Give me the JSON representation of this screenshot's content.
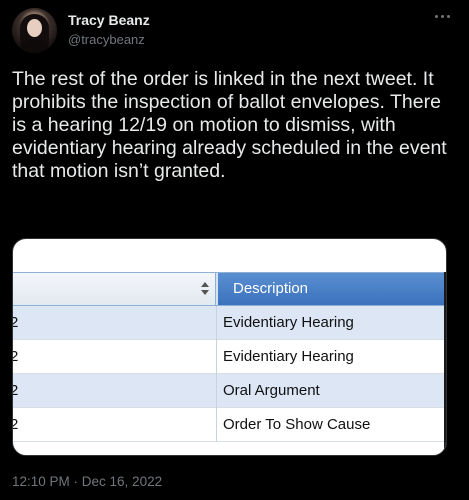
{
  "author": {
    "display_name": "Tracy Beanz",
    "handle": "@tracybeanz"
  },
  "tweet": {
    "text": "The rest of the order is linked in the next tweet. It prohibits the inspection of ballot envelopes. There is a hearing 12/19 on motion to dismiss, with evidentiary hearing already scheduled in the event that motion isn’t granted.",
    "timestamp": "12:10 PM · Dec 16, 2022"
  },
  "media": {
    "table": {
      "header": {
        "description": "Description"
      },
      "rows": [
        {
          "num": "2",
          "description": "Evidentiary Hearing"
        },
        {
          "num": "2",
          "description": "Evidentiary Hearing"
        },
        {
          "num": "2",
          "description": "Oral Argument"
        },
        {
          "num": "2",
          "description": "Order To Show Cause"
        }
      ]
    }
  },
  "icons": {
    "more": "more-options-icon",
    "sort": "sort-arrows-icon"
  },
  "colors": {
    "background": "#000000",
    "text": "#e7e9ea",
    "muted": "#71767b",
    "table_header_blue": "#3a72bd",
    "table_row_alt": "#dce6f5"
  }
}
